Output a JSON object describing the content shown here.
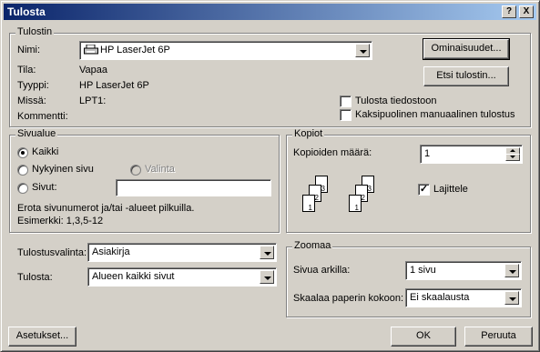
{
  "window": {
    "title": "Tulosta"
  },
  "titlebar": {
    "help_glyph": "?",
    "close_glyph": "X"
  },
  "printer": {
    "group_label": "Tulostin",
    "name_label": "Nimi:",
    "name_value": "HP LaserJet 6P",
    "status_label": "Tila:",
    "status_value": "Vapaa",
    "type_label": "Tyyppi:",
    "type_value": "HP LaserJet 6P",
    "where_label": "Missä:",
    "where_value": "LPT1:",
    "comment_label": "Kommentti:",
    "properties_button": "Ominaisuudet...",
    "find_button": "Etsi tulostin...",
    "print_to_file_label": "Tulosta tiedostoon",
    "duplex_label": "Kaksipuolinen manuaalinen tulostus",
    "print_to_file_checked": false,
    "duplex_checked": false
  },
  "page_range": {
    "group_label": "Sivualue",
    "all_label": "Kaikki",
    "current_label": "Nykyinen sivu",
    "selection_label": "Valinta",
    "pages_label": "Sivut:",
    "pages_value": "",
    "selected": "all",
    "hint_line1": "Erota sivunumerot ja/tai -alueet pilkuilla.",
    "hint_line2": "Esimerkki: 1,3,5-12"
  },
  "copies": {
    "group_label": "Kopiot",
    "count_label": "Kopioiden määrä:",
    "count_value": "1",
    "collate_label": "Lajittele",
    "collate_checked": true,
    "page_numbers": [
      "3",
      "2",
      "1"
    ]
  },
  "print_what": {
    "label": "Tulostusvalinta:",
    "value": "Asiakirja"
  },
  "print": {
    "label": "Tulosta:",
    "value": "Alueen kaikki sivut"
  },
  "zoom": {
    "group_label": "Zoomaa",
    "pages_per_sheet_label": "Sivua arkilla:",
    "pages_per_sheet_value": "1 sivu",
    "scale_label": "Skaalaa paperin kokoon:",
    "scale_value": "Ei skaalausta"
  },
  "footer": {
    "options_button": "Asetukset...",
    "ok_button": "OK",
    "cancel_button": "Peruuta"
  }
}
